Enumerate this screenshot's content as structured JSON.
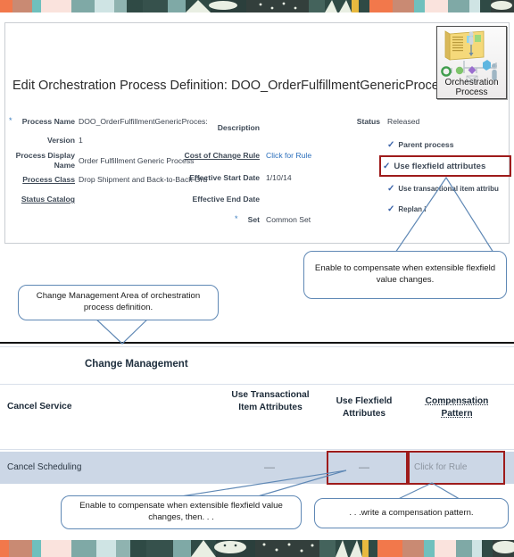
{
  "app": {
    "page_title": "Edit Orchestration Process Definition: DOO_OrderFulfillmentGenericProcess",
    "icon": {
      "name": "orchestration-process-icon",
      "caption_line1": "Orchestration",
      "caption_line2": "Process"
    }
  },
  "form": {
    "fields": [
      {
        "label": "Process Name",
        "value": "DOO_OrderFulfillmentGenericProces:",
        "required": true,
        "underline": false
      },
      {
        "label": "Version",
        "value": "1",
        "required": false,
        "underline": false
      },
      {
        "label": "Process Display Name",
        "value": "Order Fulfillment Generic Process",
        "required": false,
        "underline": false
      },
      {
        "label": "Process Class",
        "value": "Drop Shipment and Back-to-Back Ord",
        "required": false,
        "underline": true
      },
      {
        "label": "Status Catalog",
        "value": "",
        "required": false,
        "underline": true
      },
      {
        "label": "Description",
        "value": "",
        "required": false,
        "underline": false
      },
      {
        "label": "Cost of Change Rule",
        "value": "Click for Rule",
        "required": false,
        "underline": true,
        "link": true
      },
      {
        "label": "Effective Start Date",
        "value": "1/10/14",
        "required": false,
        "underline": false
      },
      {
        "label": "Effective End Date",
        "value": "",
        "required": false,
        "underline": false
      },
      {
        "label": "Set",
        "value": "Common Set",
        "required": true,
        "underline": false
      },
      {
        "label": "Status",
        "value": "Released",
        "required": false,
        "underline": false
      }
    ],
    "checkboxes": [
      {
        "label": "Parent process",
        "checked": true,
        "highlighted": false
      },
      {
        "label": "Use flexfield attributes",
        "checked": true,
        "highlighted": true
      },
      {
        "label": "Use transactional item attribu",
        "checked": true,
        "highlighted": false
      },
      {
        "label": "Replan i",
        "checked": true,
        "highlighted": false
      }
    ]
  },
  "change_management": {
    "section_title": "Change Management",
    "columns": [
      {
        "label": "Cancel Service",
        "align": "left",
        "dotted": false
      },
      {
        "label": "Use Transactional Item Attributes",
        "align": "center",
        "dotted": false
      },
      {
        "label": "Use Flexfield Attributes",
        "align": "center",
        "dotted": false
      },
      {
        "label": "Compensation Pattern",
        "align": "center",
        "dotted": true
      }
    ],
    "rows": [
      {
        "service": "Cancel Scheduling",
        "use_transactional_item_attributes": "—",
        "use_flexfield_attributes": "—",
        "compensation_pattern": "Click for Rule"
      }
    ]
  },
  "callouts": [
    {
      "name": "callout-flexfield-enable",
      "text": "Enable to compensate when extensible flexfield value changes."
    },
    {
      "name": "callout-change-management-area",
      "text": "Change Management Area of orchestration process definition."
    },
    {
      "name": "callout-enable-then",
      "text": "Enable to compensate when extensible flexfield value changes, then. . ."
    },
    {
      "name": "callout-write-pattern",
      "text": ". . .write a compensation pattern."
    }
  ],
  "colors": {
    "highlight_red": "#9e1b1b",
    "callout_border": "#5f88b5",
    "row_background": "#ccd7e6",
    "link_blue": "#2a6ebb",
    "check_blue": "#3a63a8"
  }
}
